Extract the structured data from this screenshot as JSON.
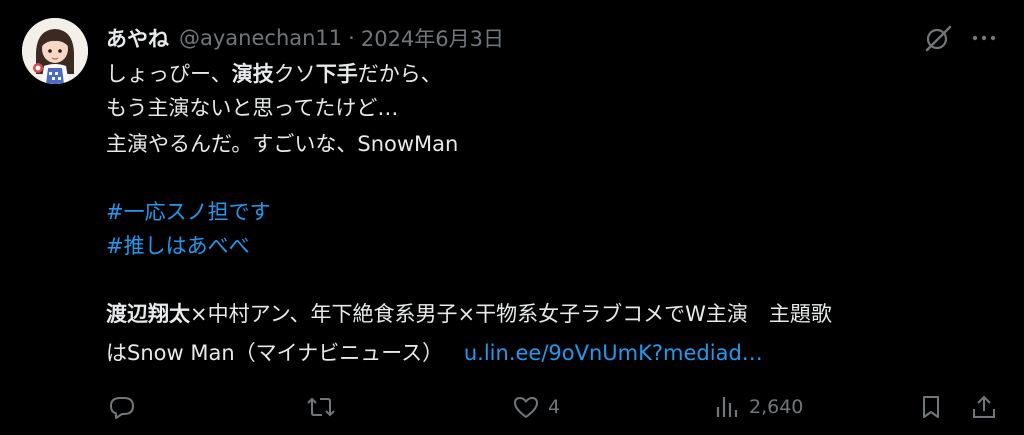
{
  "author": {
    "display_name": "あやね",
    "handle": "@ayanechan11",
    "separator": "·",
    "date": "2024年6月3日"
  },
  "tweet": {
    "line1_a": "しょっぴー、",
    "line1_b": "演技",
    "line1_c": "クソ",
    "line1_d": "下手",
    "line1_e": "だから、",
    "line2": "もう主演ないと思ってたけど…",
    "line3": "主演やるんだ。すごいな、SnowMan",
    "hashtag1": "#一応スノ担です",
    "hashtag2": "#推しはあべべ",
    "news_a": "渡辺翔太",
    "news_b": "×中村アン、年下絶食系男子×干物系女子ラブコメでW主演　主題歌",
    "news_c": "はSnow Man（マイナビニュース）",
    "link": "u.lin.ee/9oVnUmK?mediad…"
  },
  "actions": {
    "reply_icon": "reply-icon",
    "retweet_icon": "retweet-icon",
    "like_icon": "heart-icon",
    "like_count": "4",
    "views_icon": "views-icon",
    "views_count": "2,640",
    "bookmark_icon": "bookmark-icon",
    "share_icon": "share-icon"
  },
  "colors": {
    "background": "#000000",
    "text": "#e7e9ea",
    "muted": "#71767b",
    "accent": "#1d9bf0"
  }
}
